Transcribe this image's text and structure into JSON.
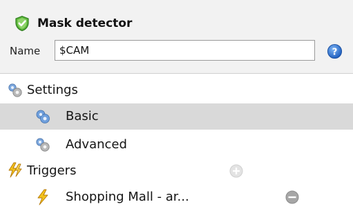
{
  "panel": {
    "title": "Mask detector",
    "name_label": "Name",
    "name_value": "$CAM"
  },
  "tree": {
    "settings": {
      "label": "Settings"
    },
    "basic": {
      "label": "Basic",
      "selected": true
    },
    "advanced": {
      "label": "Advanced"
    },
    "triggers": {
      "label": "Triggers"
    },
    "trigger_item": {
      "label": "Shopping Mall - ar..."
    }
  },
  "icons": {
    "title": "shield-check-icon",
    "help": "help-icon",
    "settings": "gears-icon",
    "basic": "gears-icon",
    "advanced": "gears-icon",
    "triggers": "lightning-icon",
    "trigger_item": "lightning-icon",
    "add": "add-icon",
    "remove": "remove-icon"
  },
  "colors": {
    "header_bg": "#f2f2f2",
    "selected_row_bg": "#d9d9d9",
    "shield_green": "#5bb53a",
    "help_blue": "#2f78d6",
    "lightning_yellow": "#f3c21c"
  }
}
